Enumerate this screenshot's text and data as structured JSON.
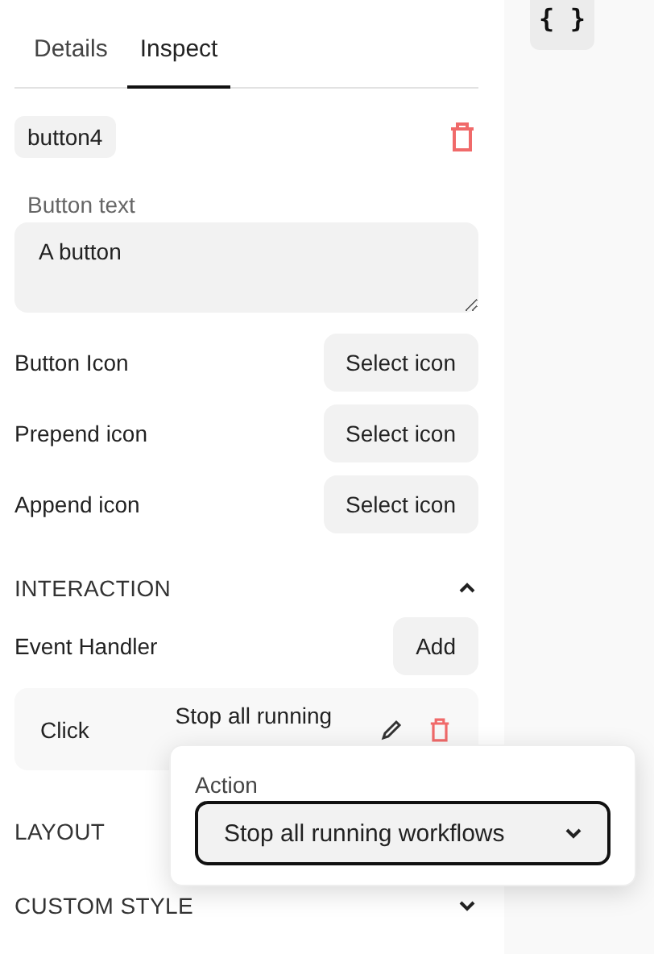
{
  "tabs": [
    {
      "label": "Details",
      "selected": false
    },
    {
      "label": "Inspect",
      "selected": true
    }
  ],
  "side_button": {
    "label": "{ }"
  },
  "component_name": "button4",
  "button_text_field": {
    "label": "Button text",
    "value": "A button"
  },
  "icon_rows": [
    {
      "label": "Button Icon",
      "button": "Select icon"
    },
    {
      "label": "Prepend icon",
      "button": "Select icon"
    },
    {
      "label": "Append icon",
      "button": "Select icon"
    }
  ],
  "interaction": {
    "title": "INTERACTION",
    "expanded": true,
    "event_handler_label": "Event Handler",
    "add_button": "Add",
    "handlers": [
      {
        "event": "Click",
        "action": "Stop all running"
      }
    ]
  },
  "collapsed_sections": [
    {
      "title": "LAYOUT"
    },
    {
      "title": "CUSTOM STYLE",
      "expanded": false
    }
  ],
  "action_popover": {
    "label": "Action",
    "value": "Stop all running workflows"
  }
}
